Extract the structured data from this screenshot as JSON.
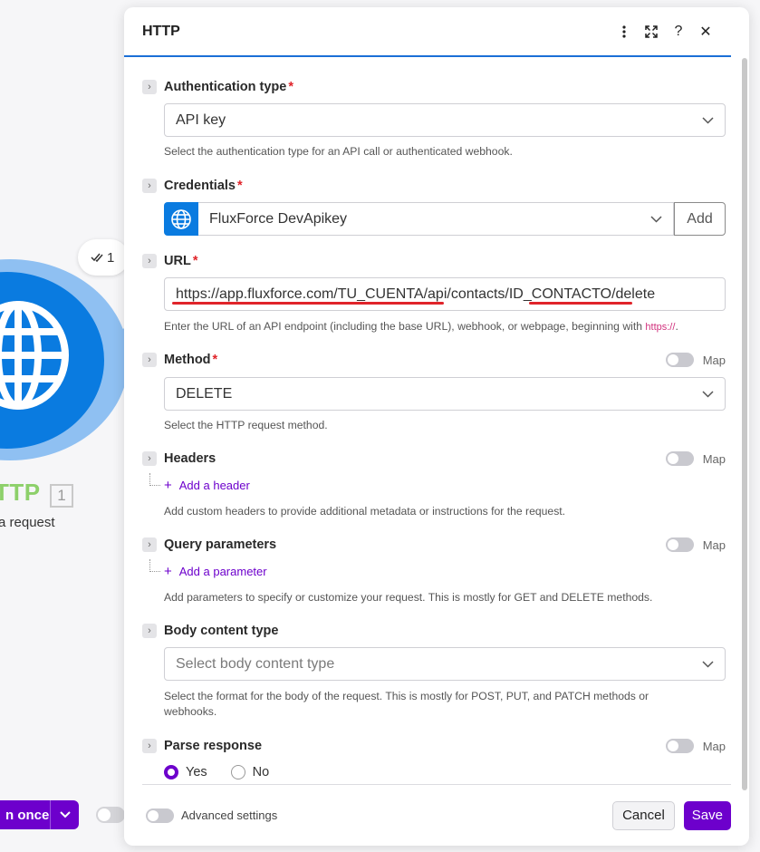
{
  "canvas": {
    "ops_count": "1",
    "module_title": "HTTP",
    "module_title_visible": "TTP",
    "module_number": "1",
    "module_subtitle": "a request",
    "run_once_label": "n once"
  },
  "panel": {
    "title": "HTTP",
    "header_icons": [
      "more-vertical-icon",
      "expand-icon",
      "help-icon",
      "close-icon"
    ],
    "help_glyph": "?",
    "close_glyph": "✕",
    "map_label": "Map",
    "auth": {
      "label": "Authentication type",
      "required_mark": "*",
      "value": "API key",
      "help": "Select the authentication type for an API call or authenticated webhook."
    },
    "credentials": {
      "label": "Credentials",
      "required_mark": "*",
      "value": "FluxForce DevApikey",
      "add_label": "Add"
    },
    "url": {
      "label": "URL",
      "required_mark": "*",
      "value_part1": "https://app.fluxforce.com/TU_CUENTA",
      "value_part2": "/api/contacts/",
      "value_part3": "ID_CONTACTO",
      "value_part4": "/delete",
      "help_prefix": "Enter the URL of an API endpoint (including the base URL), webhook, or webpage, beginning with ",
      "help_link": "https://",
      "help_suffix": "."
    },
    "method": {
      "label": "Method",
      "required_mark": "*",
      "value": "DELETE",
      "help": "Select the HTTP request method."
    },
    "headers": {
      "label": "Headers",
      "add_label": "Add a header",
      "help": "Add custom headers to provide additional metadata or instructions for the request."
    },
    "query": {
      "label": "Query parameters",
      "add_label": "Add a parameter",
      "help": "Add parameters to specify or customize your request. This is mostly for GET and DELETE methods."
    },
    "body": {
      "label": "Body content type",
      "placeholder": "Select body content type",
      "help": "Select the format for the body of the request. This is mostly for POST, PUT, and PATCH methods or webhooks."
    },
    "parse": {
      "label": "Parse response",
      "options": [
        "Yes",
        "No"
      ],
      "selected": "Yes"
    },
    "footer": {
      "advanced_label": "Advanced settings",
      "cancel_label": "Cancel",
      "save_label": "Save"
    }
  },
  "colors": {
    "accent": "#6d00cc",
    "brand_blue": "#0a7be0",
    "header_rule": "#1b6fd6",
    "required": "#e0242a",
    "module_title": "#8dd06a"
  }
}
